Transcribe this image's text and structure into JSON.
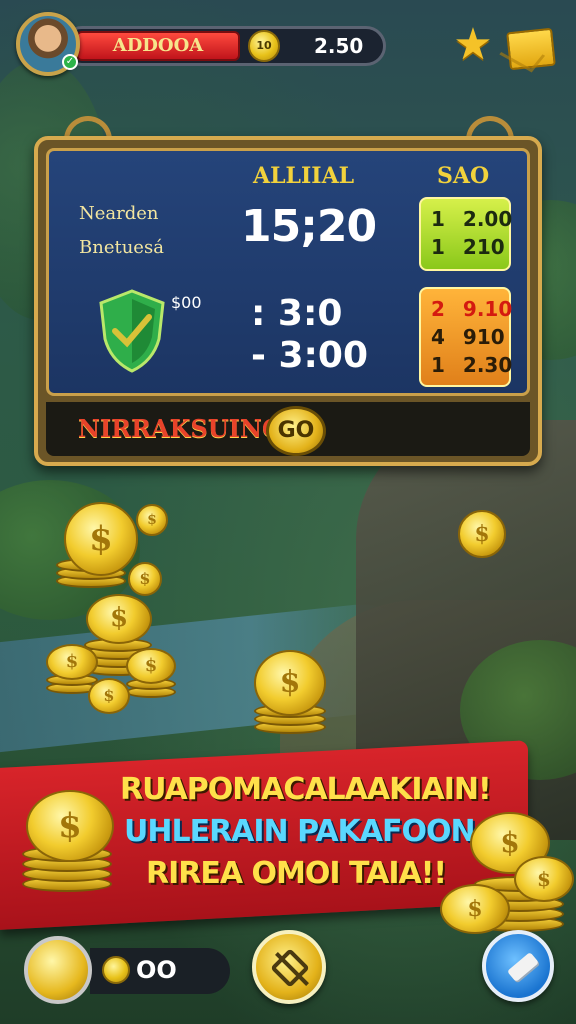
{
  "hud": {
    "red_bar_text": "ADDOOA",
    "coin_label": "10",
    "balance": "2.50"
  },
  "scoreboard": {
    "header_center": "ALLIIAL",
    "header_right": "SAO",
    "label_1": "Nearden",
    "label_2": "Bnetuesá",
    "main_time": "15;20",
    "prize": "$00",
    "time_2": ": 3:0",
    "time_3": "- 3:00",
    "green_rows": [
      [
        "1",
        "2.00"
      ],
      [
        "1",
        "210"
      ]
    ],
    "orange_rows": [
      [
        "2",
        "9.10"
      ],
      [
        "4",
        "910"
      ],
      [
        "1",
        "2.30"
      ]
    ],
    "strip_label": "NIRRAKSUING",
    "go_label": "GO"
  },
  "banner": {
    "line1": "RUAPOMACALAAKIAIN!",
    "line2": "UHLERAIN PAKAFOON",
    "line3": "RIREA OMOI TAIA!!"
  },
  "bottom": {
    "count": "OO"
  },
  "colors": {
    "accent_gold": "#e3b21a",
    "banner_red": "#c01a20",
    "board_blue": "#25447a",
    "green_box": "#a6d42a",
    "orange_box": "#f09a2a"
  },
  "icons": [
    "avatar",
    "coin-icon",
    "star-icon",
    "mail-icon",
    "shield-check-icon",
    "coin-stack-icon",
    "no-ads-icon",
    "eraser-icon"
  ]
}
